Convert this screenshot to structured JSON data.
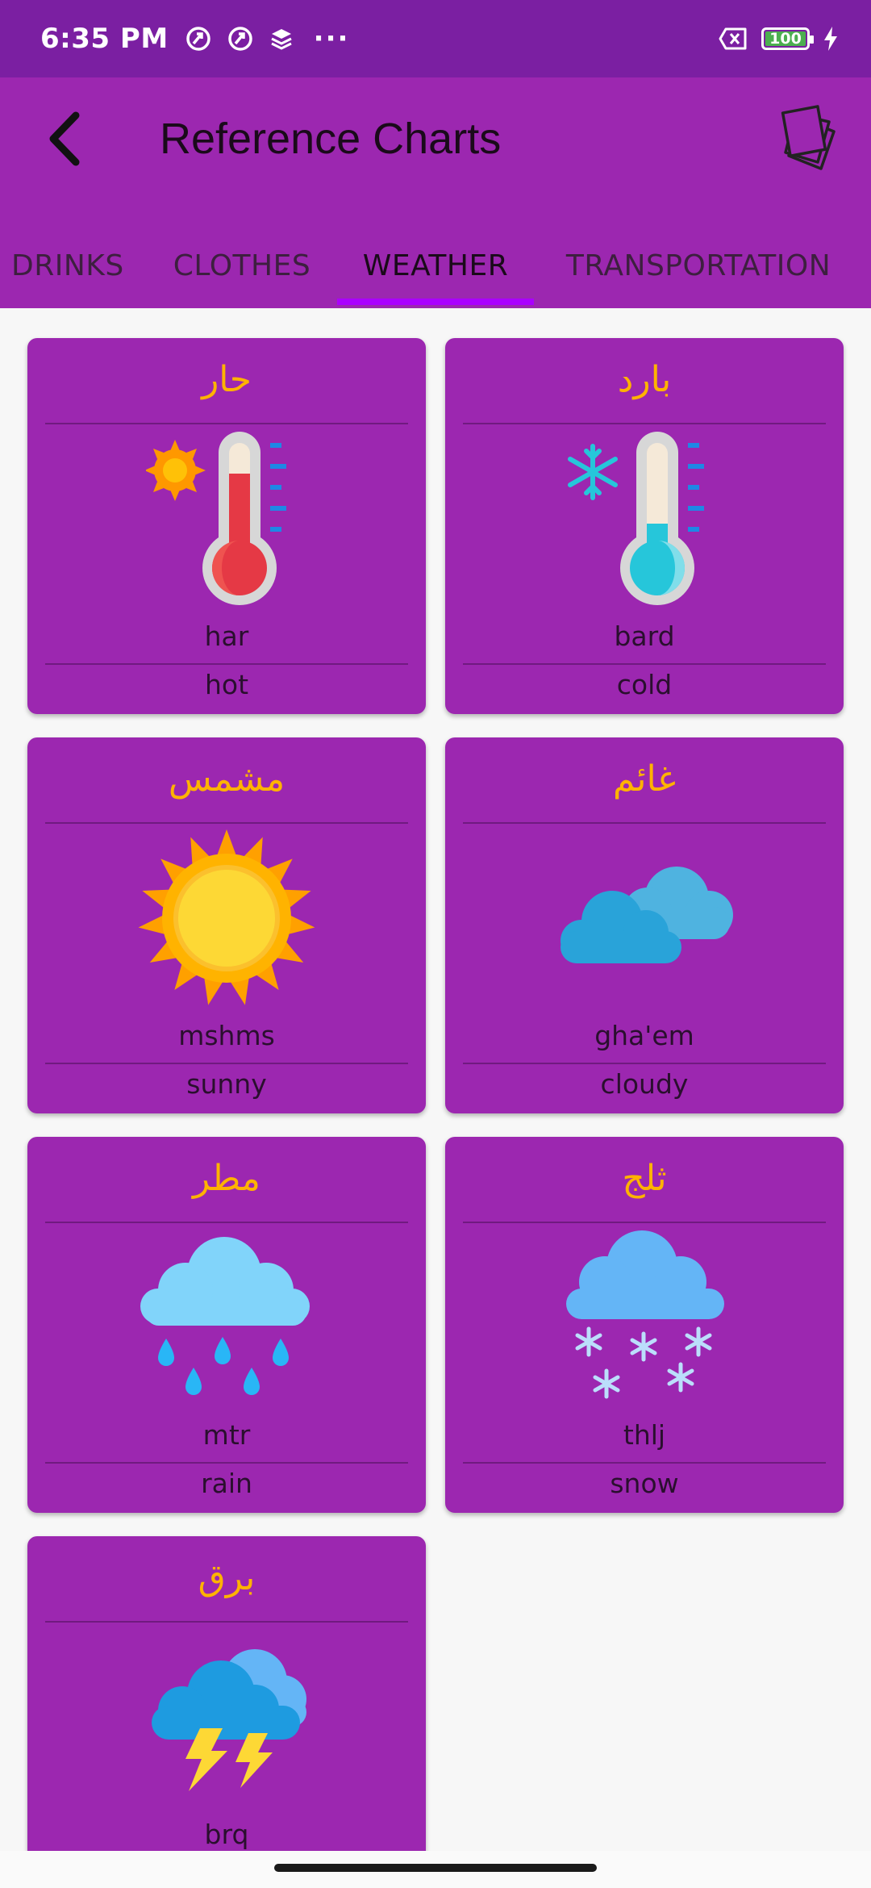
{
  "status_bar": {
    "time": "6:35 PM",
    "dots": "···",
    "battery": "100"
  },
  "app_bar": {
    "title": "Reference Charts"
  },
  "tabs": [
    {
      "label": "DRINKS"
    },
    {
      "label": "CLOTHES"
    },
    {
      "label": "WEATHER",
      "active": true
    },
    {
      "label": "TRANSPORTATION"
    }
  ],
  "cards": [
    {
      "arabic": "حار",
      "translit": "har",
      "english": "hot",
      "icon": "hot-thermometer-icon"
    },
    {
      "arabic": "بارد",
      "translit": "bard",
      "english": "cold",
      "icon": "cold-thermometer-icon"
    },
    {
      "arabic": "مشمس",
      "translit": "mshms",
      "english": "sunny",
      "icon": "sun-icon"
    },
    {
      "arabic": "غائم",
      "translit": "gha'em",
      "english": "cloudy",
      "icon": "clouds-icon"
    },
    {
      "arabic": "مطر",
      "translit": "mtr",
      "english": "rain",
      "icon": "rain-cloud-icon"
    },
    {
      "arabic": "ثلج",
      "translit": "thlj",
      "english": "snow",
      "icon": "snow-cloud-icon"
    },
    {
      "arabic": "برق",
      "translit": "brq",
      "english": "",
      "icon": "lightning-cloud-icon"
    }
  ],
  "colors": {
    "status_bar": "#7b1fa2",
    "primary": "#9c27b0",
    "accent": "#aa00ff",
    "arabic_text": "#ffb300",
    "background": "#f7f7f7"
  }
}
